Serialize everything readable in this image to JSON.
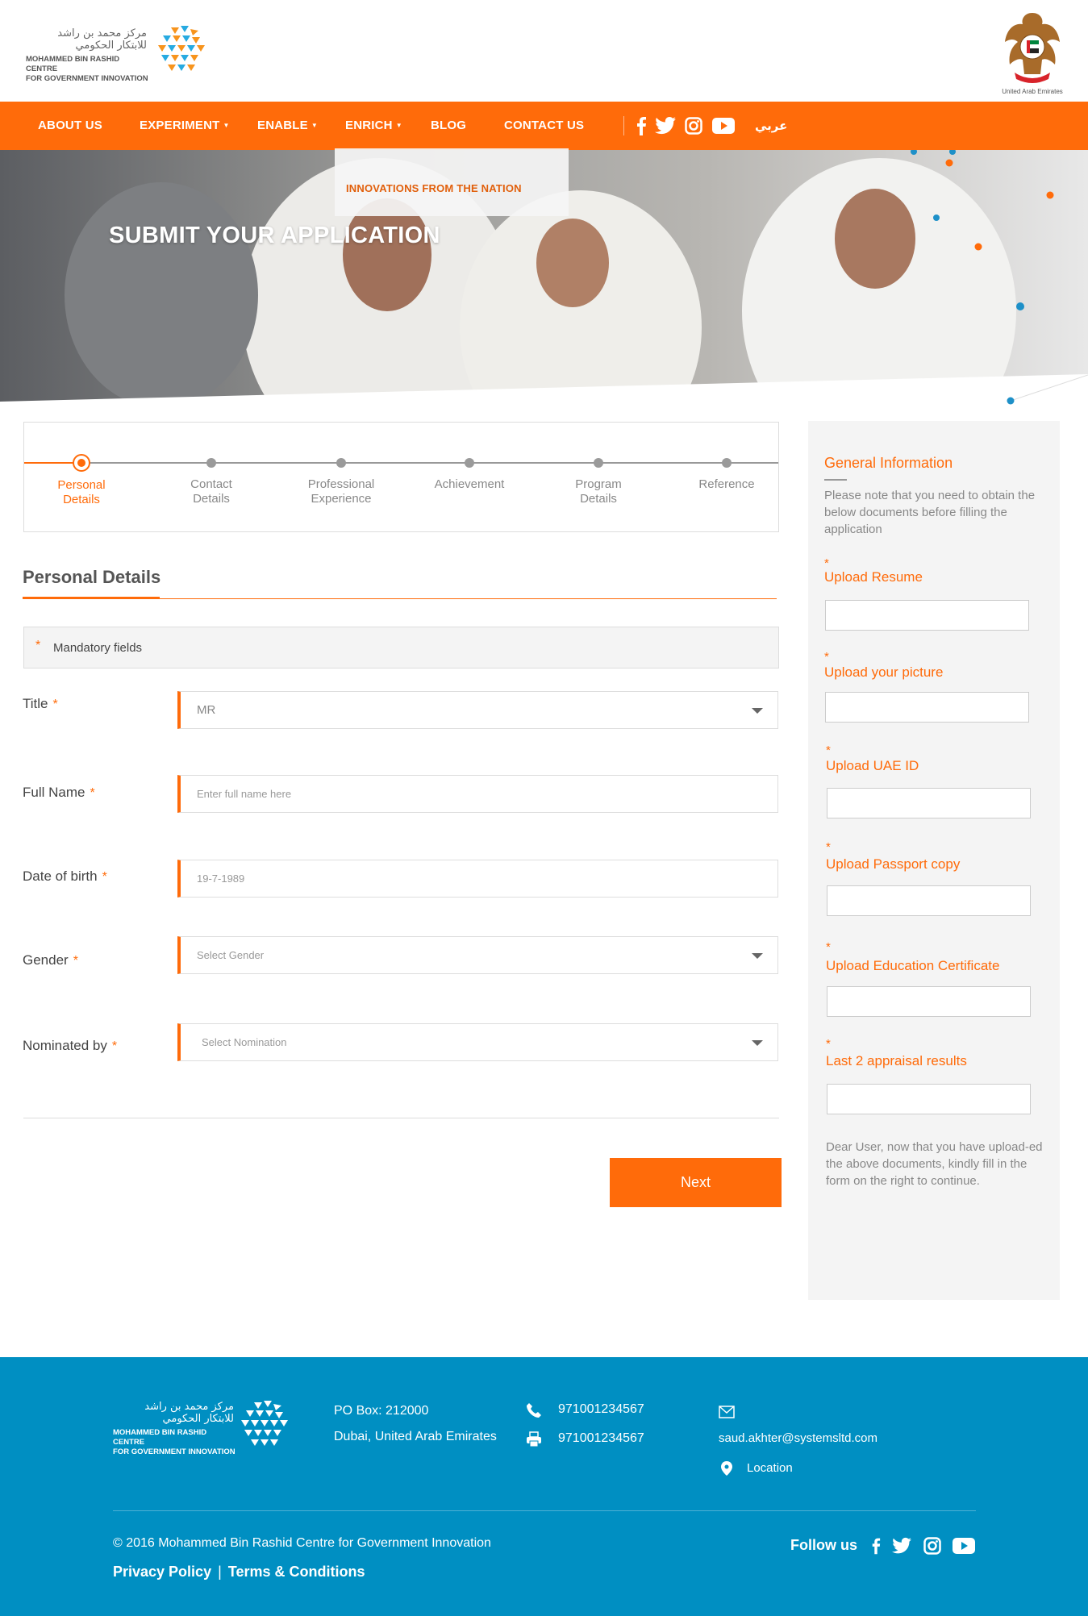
{
  "header": {
    "logo_arabic": "مركز محمد بن راشد للابتكار الحكومي",
    "logo_line1": "MOHAMMED BIN RASHID CENTRE",
    "logo_line2": "FOR GOVERNMENT INNOVATION",
    "emblem_caption": "United Arab Emirates"
  },
  "nav": {
    "items": [
      {
        "label": "ABOUT US"
      },
      {
        "label": "EXPERIMENT"
      },
      {
        "label": "ENABLE"
      },
      {
        "label": "ENRICH"
      },
      {
        "label": "BLOG"
      },
      {
        "label": "CONTACT US"
      }
    ],
    "social": [
      "facebook-icon",
      "twitter-icon",
      "instagram-icon",
      "youtube-icon"
    ],
    "language": "عربي",
    "dropdown_item": "INNOVATIONS FROM THE NATION"
  },
  "hero": {
    "title": "SUBMIT YOUR APPLICATION"
  },
  "steps": [
    {
      "line1": "Personal",
      "line2": "Details",
      "active": true
    },
    {
      "line1": "Contact",
      "line2": "Details",
      "active": false
    },
    {
      "line1": "Professional",
      "line2": "Experience",
      "active": false
    },
    {
      "line1": "Achievement",
      "line2": "",
      "active": false
    },
    {
      "line1": "Program",
      "line2": "Details",
      "active": false
    },
    {
      "line1": "Reference",
      "line2": "",
      "active": false
    }
  ],
  "form": {
    "section_title": "Personal Details",
    "mandatory_star": "*",
    "mandatory_text": "Mandatory fields",
    "required_mark": "*",
    "title_label": "Title",
    "title_value": "MR",
    "fullname_label": "Full Name",
    "fullname_placeholder": "Enter full name here",
    "dob_label": "Date of birth",
    "dob_placeholder": "19-7-1989",
    "gender_label": "Gender",
    "gender_placeholder": "Select Gender",
    "nominated_label": "Nominated by",
    "nominated_placeholder": "Select Nomination",
    "next_label": "Next"
  },
  "sidebar": {
    "title": "General Information",
    "note": "Please note that you need to obtain the below documents before filling the application",
    "uploads": [
      {
        "label": "Upload Resume"
      },
      {
        "label": "Upload your picture"
      },
      {
        "label": "Upload UAE ID"
      },
      {
        "label": "Upload Passport copy"
      },
      {
        "label": "Upload Education Certificate"
      },
      {
        "label": "Last 2 appraisal results"
      }
    ],
    "required_mark": "*",
    "footer_note": "Dear User, now that you have upload-ed the above documents, kindly fill in the form on the right to continue."
  },
  "footer": {
    "po_box": "PO Box: 212000",
    "city": "Dubai, United Arab Emirates",
    "phone": "971001234567",
    "fax": "971001234567",
    "email": "saud.akhter@systemsltd.com",
    "location": "Location",
    "copyright": "© 2016 Mohammed Bin Rashid Centre for Government Innovation",
    "privacy": "Privacy Policy",
    "separator": "|",
    "terms": "Terms & Conditions",
    "follow": "Follow us"
  },
  "colors": {
    "accent": "#ff6b0a",
    "footer_bg": "#008fc2",
    "sidebar_bg": "#f4f4f4"
  }
}
